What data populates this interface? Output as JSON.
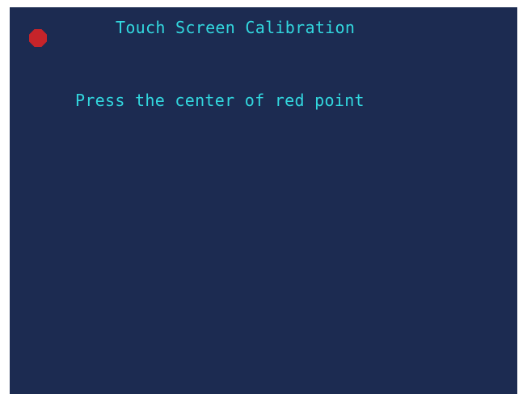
{
  "screen": {
    "title": "Touch Screen Calibration",
    "instruction": "Press the center of red point",
    "background_color": "#1c2b51",
    "text_color": "#32d7de",
    "calibration_point": {
      "icon": "red-point-icon",
      "color": "#c6242a"
    }
  }
}
